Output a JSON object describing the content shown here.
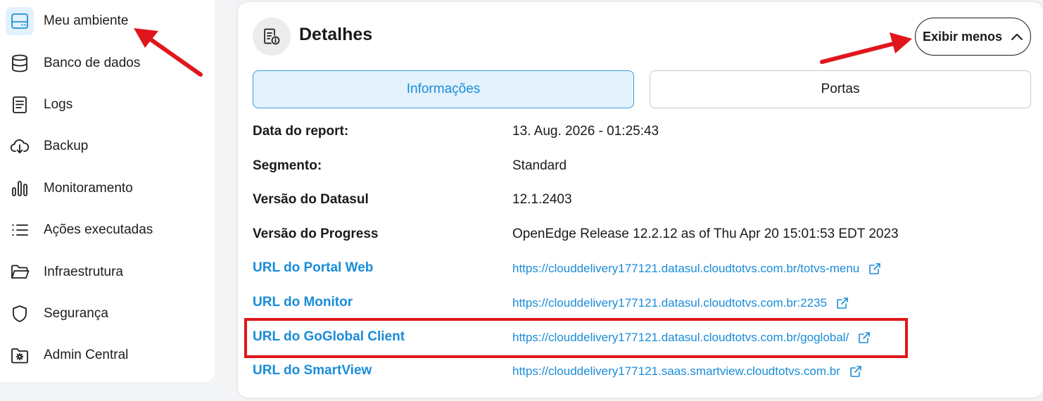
{
  "sidebar": {
    "items": [
      {
        "label": "Meu ambiente",
        "icon": "server-icon"
      },
      {
        "label": "Banco de dados",
        "icon": "database-icon"
      },
      {
        "label": "Logs",
        "icon": "document-icon"
      },
      {
        "label": "Backup",
        "icon": "cloud-download-icon"
      },
      {
        "label": "Monitoramento",
        "icon": "bar-chart-icon"
      },
      {
        "label": "Ações executadas",
        "icon": "list-icon"
      },
      {
        "label": "Infraestrutura",
        "icon": "folder-icon"
      },
      {
        "label": "Segurança",
        "icon": "shield-icon"
      },
      {
        "label": "Admin Central",
        "icon": "gear-folder-icon"
      }
    ]
  },
  "details": {
    "title": "Detalhes",
    "icon": "document-info-icon",
    "toggle_label": "Exibir menos",
    "tabs": [
      {
        "label": "Informações"
      },
      {
        "label": "Portas"
      }
    ],
    "rows": [
      {
        "label": "Data do report:",
        "value": "13. Aug. 2026 - 01:25:43"
      },
      {
        "label": "Segmento:",
        "value": "Standard"
      },
      {
        "label": "Versão do Datasul",
        "value": "12.1.2403"
      },
      {
        "label": "Versão do Progress",
        "value": "OpenEdge Release 12.2.12 as of Thu Apr 20 15:01:53 EDT 2023"
      },
      {
        "label": "URL do Portal Web",
        "value": "https://clouddelivery177121.datasul.cloudtotvs.com.br/totvs-menu"
      },
      {
        "label": "URL do Monitor",
        "value": "https://clouddelivery177121.datasul.cloudtotvs.com.br:2235"
      },
      {
        "label": "URL do GoGlobal Client",
        "value": "https://clouddelivery177121.datasul.cloudtotvs.com.br/goglobal/"
      },
      {
        "label": "URL do SmartView",
        "value": "https://clouddelivery177121.saas.smartview.cloudtotvs.com.br"
      }
    ]
  },
  "colors": {
    "accent": "#1a8cd8",
    "annotation": "#e0161c",
    "active_tab_bg": "#e3f2fc"
  }
}
